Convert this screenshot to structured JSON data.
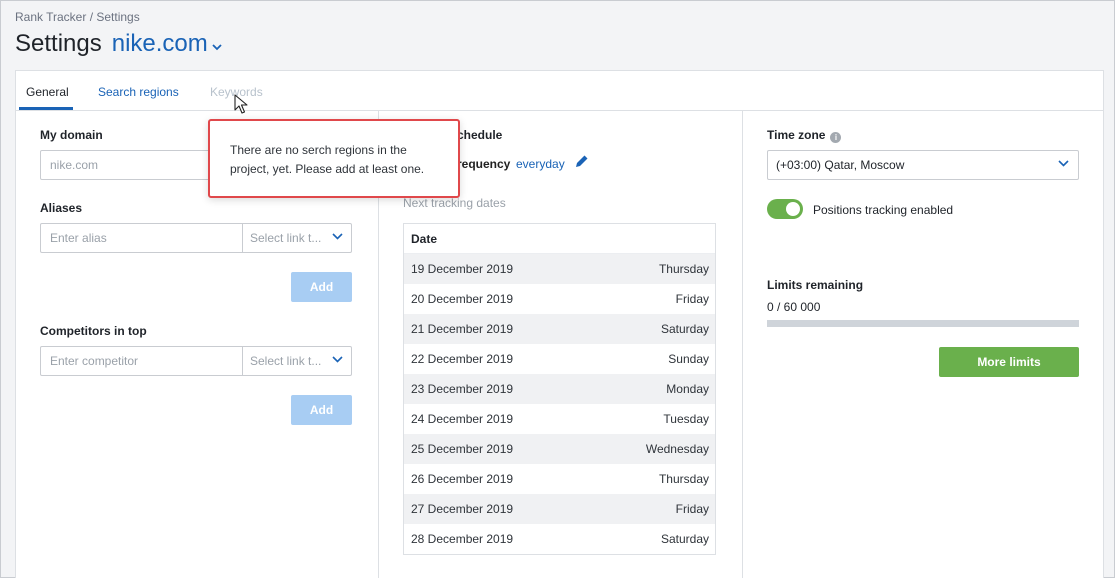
{
  "breadcrumb": "Rank Tracker / Settings",
  "page_title": "Settings",
  "project_domain": "nike.com",
  "tabs": [
    {
      "label": "General",
      "state": "active"
    },
    {
      "label": "Search regions",
      "state": "link"
    },
    {
      "label": "Keywords",
      "state": "disabled"
    }
  ],
  "general": {
    "my_domain_label": "My domain",
    "my_domain_placeholder": "nike.com",
    "aliases_label": "Aliases",
    "alias_placeholder": "Enter alias",
    "alias_select_placeholder": "Select link t...",
    "add_label": "Add",
    "competitors_label": "Competitors in top",
    "competitor_placeholder": "Enter competitor",
    "competitor_select_placeholder": "Select link t...",
    "add2_label": "Add"
  },
  "schedule": {
    "heading": "chedule",
    "frequency_label": "requency",
    "frequency_value": "everyday",
    "next_dates_label": "Next tracking dates",
    "table_header": "Date",
    "rows": [
      {
        "date": "19 December 2019",
        "day": "Thursday"
      },
      {
        "date": "20 December 2019",
        "day": "Friday"
      },
      {
        "date": "21 December 2019",
        "day": "Saturday"
      },
      {
        "date": "22 December 2019",
        "day": "Sunday"
      },
      {
        "date": "23 December 2019",
        "day": "Monday"
      },
      {
        "date": "24 December 2019",
        "day": "Tuesday"
      },
      {
        "date": "25 December 2019",
        "day": "Wednesday"
      },
      {
        "date": "26 December 2019",
        "day": "Thursday"
      },
      {
        "date": "27 December 2019",
        "day": "Friday"
      },
      {
        "date": "28 December 2019",
        "day": "Saturday"
      }
    ]
  },
  "right": {
    "timezone_label": "Time zone",
    "timezone_value": "(+03:00) Qatar, Moscow",
    "tracking_toggle_label": "Positions tracking enabled",
    "tracking_enabled": true,
    "limits_label": "Limits remaining",
    "limits_value": "0 / 60 000",
    "limits_used_fraction": 0,
    "more_limits_label": "More limits"
  },
  "tooltip": {
    "text": "There are no serch regions in the project, yet. Please add at least one."
  },
  "colors": {
    "accent": "#1a63b6",
    "success": "#6ab04c",
    "button_disabled": "#a8cdf3",
    "tooltip_border": "#e0484b"
  }
}
